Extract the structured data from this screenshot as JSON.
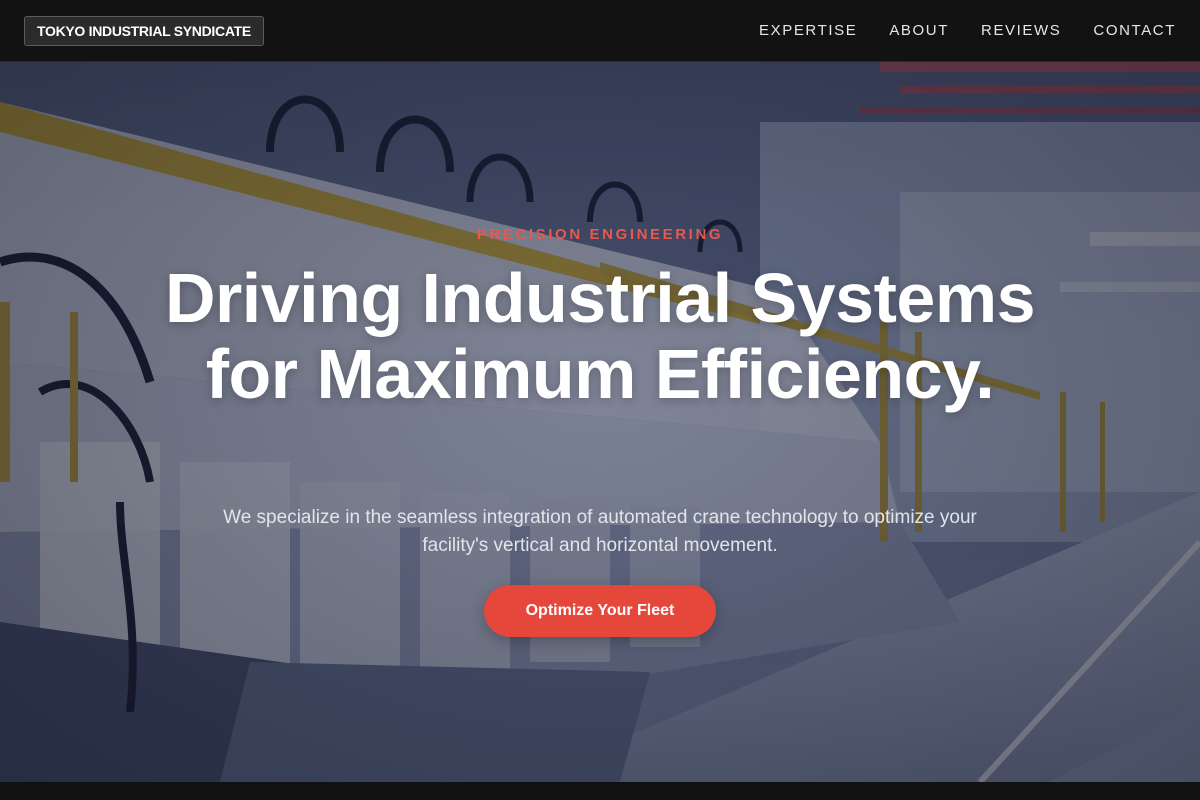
{
  "header": {
    "brand": "TOKYO INDUSTRIAL SYNDICATE",
    "nav": [
      {
        "label": "EXPERTISE"
      },
      {
        "label": "ABOUT"
      },
      {
        "label": "REVIEWS"
      },
      {
        "label": "CONTACT"
      }
    ]
  },
  "hero": {
    "eyebrow": "PRECISION ENGINEERING",
    "headline": "Driving Industrial Systems for Maximum Efficiency.",
    "subtext": "We specialize in the seamless integration of automated crane technology to optimize your facility's vertical and horizontal movement.",
    "cta_label": "Optimize Your Fleet",
    "background_image": "factory-production-line"
  },
  "colors": {
    "header_bg": "#121212",
    "accent": "#e5473b",
    "eyebrow": "#e8584c",
    "headline": "#ffffff",
    "overlay": "#141830"
  }
}
